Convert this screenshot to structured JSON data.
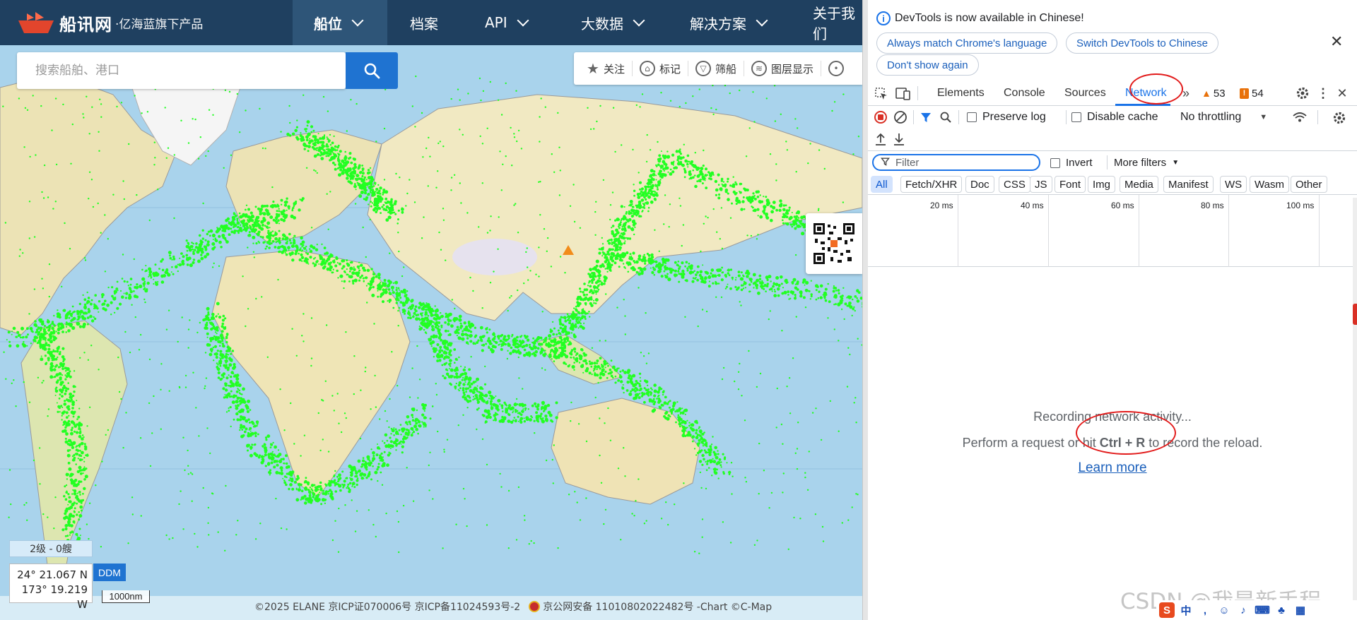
{
  "site": {
    "logo_name": "船讯网",
    "logo_subtitle": "·亿海蓝旗下产品",
    "nav": [
      {
        "label": "船位",
        "has_dropdown": true,
        "active": true
      },
      {
        "label": "档案",
        "has_dropdown": false
      },
      {
        "label": "API",
        "has_dropdown": true
      },
      {
        "label": "大数据",
        "has_dropdown": true
      },
      {
        "label": "解决方案",
        "has_dropdown": true
      },
      {
        "label": "关于我们",
        "has_dropdown": false
      }
    ],
    "search_placeholder": "搜索船舶、港口",
    "map_tools": [
      "关注",
      "标记",
      "筛船",
      "图层显示"
    ],
    "level_text": "2级 - 0艘",
    "coord_lat": "24° 21.067 N",
    "coord_lon": "173° 19.219 W",
    "coord_format": "DDM",
    "scale_label": "1000nm",
    "copyright_left": "©2025 ELANE  京ICP证070006号   京ICP备11024593号-2",
    "copyright_right": "京公网安备 11010802022482号  -Chart ©C-Map",
    "colors": {
      "nav_bg": "#1f4060",
      "accent": "#1f73d1",
      "ship_dot": "#22ff22",
      "ocean": "#a9d3ec",
      "land": "#f1e9c2"
    }
  },
  "devtools": {
    "notice_text": "DevTools is now available in Chinese!",
    "notice_btn_match": "Always match Chrome's language",
    "notice_btn_switch": "Switch DevTools to Chinese",
    "notice_btn_dontshow": "Don't show again",
    "tabs": [
      "Elements",
      "Console",
      "Sources",
      "Network"
    ],
    "active_tab": "Network",
    "warnings_count": "53",
    "errors_count": "54",
    "preserve_log": "Preserve log",
    "disable_cache": "Disable cache",
    "throttling": "No throttling",
    "filter_placeholder": "Filter",
    "invert": "Invert",
    "more_filters": "More filters",
    "type_filters": [
      "All",
      "Fetch/XHR",
      "Doc",
      "CSS",
      "JS",
      "Font",
      "Img",
      "Media",
      "Manifest",
      "WS",
      "Wasm",
      "Other"
    ],
    "timeline_ticks": [
      "20 ms",
      "40 ms",
      "60 ms",
      "80 ms",
      "100 ms"
    ],
    "recording_text": "Recording network activity...",
    "hint_before": "Perform a request or hit ",
    "hint_keys": "Ctrl + R",
    "hint_after": " to record the reload.",
    "learn_more": "Learn more"
  },
  "overlay": {
    "watermark": "CSDN @我是新手程",
    "ime_lang": "中"
  }
}
